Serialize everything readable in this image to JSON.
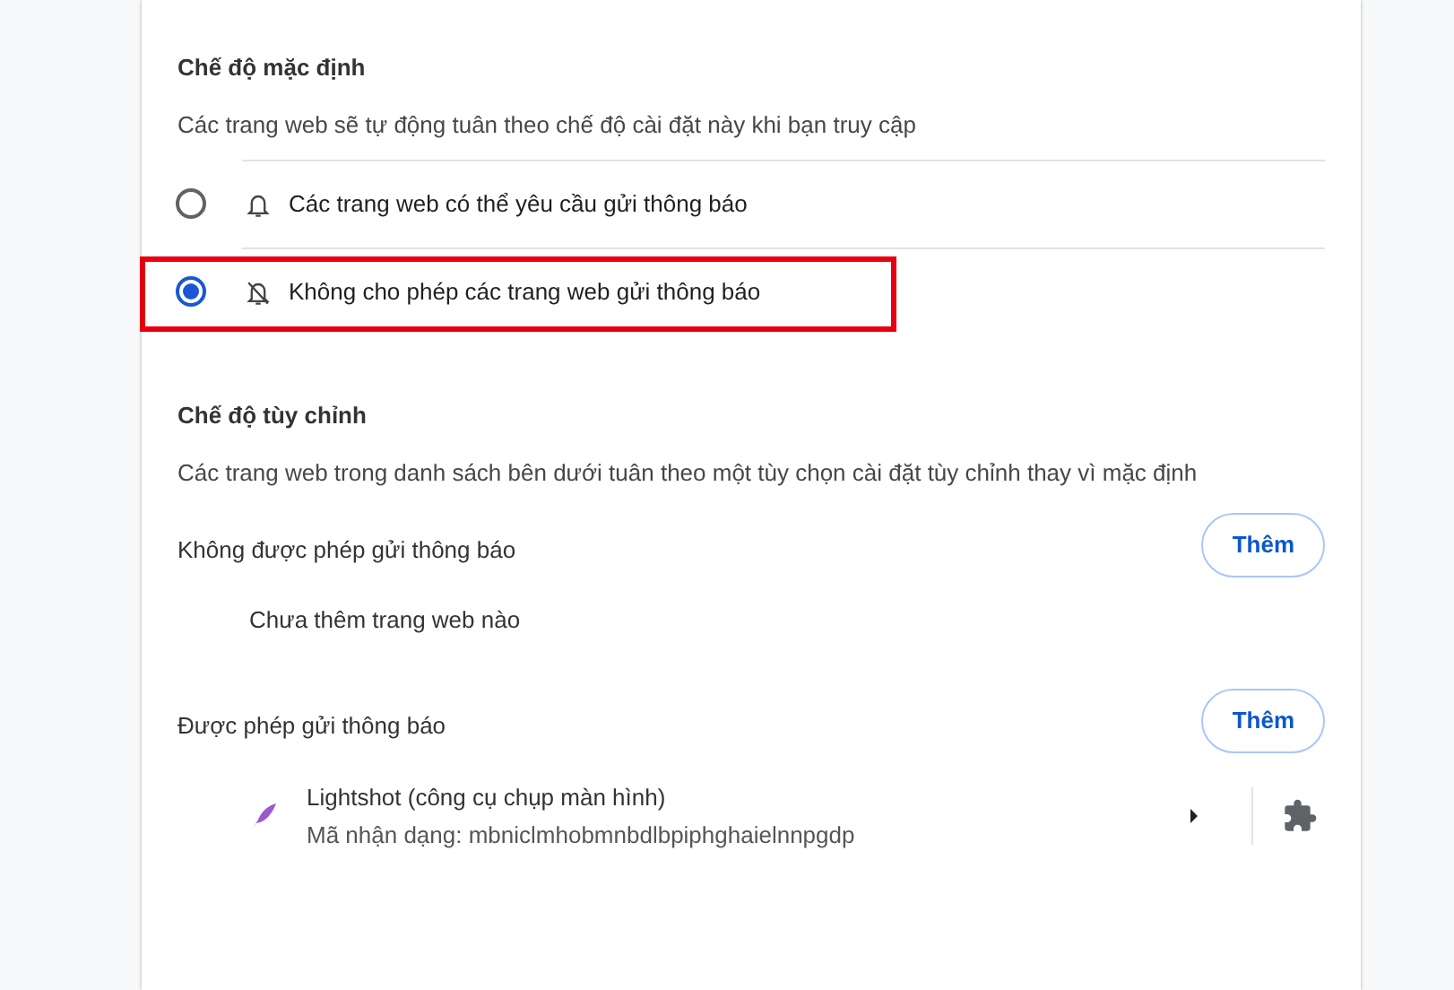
{
  "default_section": {
    "title": "Chế độ mặc định",
    "description": "Các trang web sẽ tự động tuân theo chế độ cài đặt này khi bạn truy cập",
    "options": [
      {
        "kind": "bell",
        "label": "Các trang web có thể yêu cầu gửi thông báo",
        "selected": false,
        "highlighted": false
      },
      {
        "kind": "bell-off",
        "label": "Không cho phép các trang web gửi thông báo",
        "selected": true,
        "highlighted": true
      }
    ]
  },
  "custom_section": {
    "title": "Chế độ tùy chỉnh",
    "description": "Các trang web trong danh sách bên dưới tuân theo một tùy chọn cài đặt tùy chỉnh thay vì mặc định",
    "lists": [
      {
        "title": "Không được phép gửi thông báo",
        "button": "Thêm",
        "empty_text": "Chưa thêm trang web nào"
      },
      {
        "title": "Được phép gửi thông báo",
        "button": "Thêm",
        "sites": [
          {
            "name": "Lightshot (công cụ chụp màn hình)",
            "id_text": "Mã nhận dạng: mbniclmhobmnbdlbpiphghaielnnpgdp"
          }
        ]
      }
    ]
  }
}
